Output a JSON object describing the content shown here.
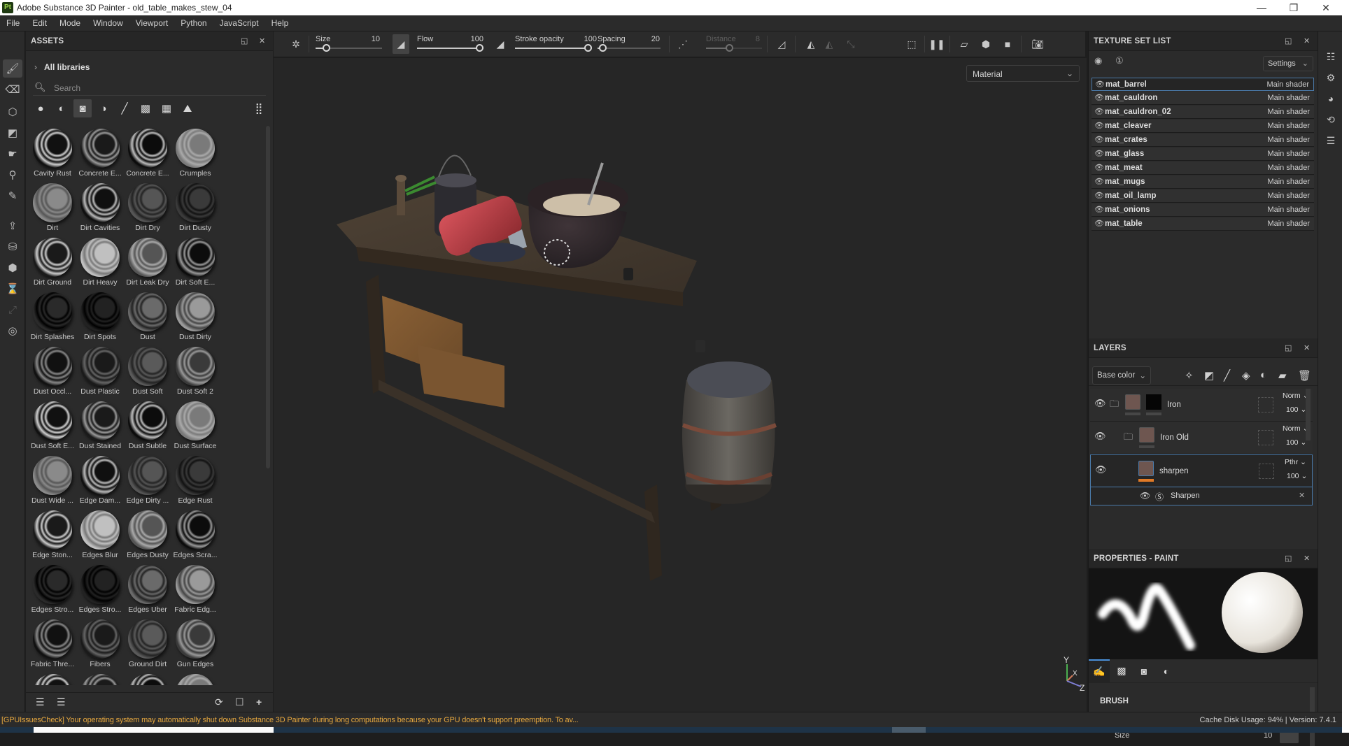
{
  "window": {
    "title": "Adobe Substance 3D Painter - old_table_makes_stew_04",
    "app_icon": "Pt",
    "controls": {
      "minimize": "—",
      "maximize": "❐",
      "close": "✕"
    }
  },
  "menu": [
    "File",
    "Edit",
    "Mode",
    "Window",
    "Viewport",
    "Python",
    "JavaScript",
    "Help"
  ],
  "left_tools": [
    {
      "icon": "paint-brush-icon",
      "glyph": "🖌",
      "active": true
    },
    {
      "icon": "eraser-icon",
      "glyph": "⌫"
    },
    {
      "icon": "projection-icon",
      "glyph": "⬡"
    },
    {
      "icon": "polygon-fill-icon",
      "glyph": "◩"
    },
    {
      "icon": "smudge-icon",
      "glyph": "☛"
    },
    {
      "icon": "clone-stamp-icon",
      "glyph": "⚲"
    },
    {
      "icon": "color-picker-icon",
      "glyph": "✎"
    },
    {
      "icon": "export-icon",
      "glyph": "⇪"
    },
    {
      "icon": "bake-icon",
      "glyph": "⛁"
    },
    {
      "icon": "uv-icon",
      "glyph": "⬢"
    },
    {
      "icon": "hourglass-icon",
      "glyph": "⌛"
    },
    {
      "icon": "transform-icon",
      "glyph": "⤢"
    },
    {
      "icon": "iray-icon",
      "glyph": "◎"
    }
  ],
  "assets": {
    "title": "ASSETS",
    "library": "All libraries",
    "search_placeholder": "Search",
    "filters": [
      {
        "icon": "material-filter-icon",
        "glyph": "●"
      },
      {
        "icon": "smart-material-filter-icon",
        "glyph": "◐"
      },
      {
        "icon": "smart-mask-filter-icon",
        "glyph": "◙",
        "active": true
      },
      {
        "icon": "generator-filter-icon",
        "glyph": "◑"
      },
      {
        "icon": "brush-filter-icon",
        "glyph": "╱"
      },
      {
        "icon": "alpha-filter-icon",
        "glyph": "▩"
      },
      {
        "icon": "texture-filter-icon",
        "glyph": "▦"
      },
      {
        "icon": "environment-filter-icon",
        "glyph": "⛰"
      }
    ],
    "view_toggle_glyph": "⣿",
    "items": [
      "Cavity Rust",
      "Concrete E...",
      "Concrete E...",
      "Crumples",
      "Dirt",
      "Dirt Cavities",
      "Dirt Dry",
      "Dirt Dusty",
      "Dirt Ground",
      "Dirt Heavy",
      "Dirt Leak Dry",
      "Dirt Soft E...",
      "Dirt Splashes",
      "Dirt Spots",
      "Dust",
      "Dust Dirty",
      "Dust Occl...",
      "Dust Plastic",
      "Dust Soft",
      "Dust Soft 2",
      "Dust Soft E...",
      "Dust Stained",
      "Dust Subtle",
      "Dust Surface",
      "Dust Wide ...",
      "Edge Dam...",
      "Edge Dirty ...",
      "Edge Rust",
      "Edge Ston...",
      "Edges Blur",
      "Edges Dusty",
      "Edges Scra...",
      "Edges Stro...",
      "Edges Stro...",
      "Edges Uber",
      "Fabric Edg...",
      "Fabric Thre...",
      "Fibers",
      "Ground Dirt",
      "Gun Edges",
      "",
      "",
      "",
      ""
    ],
    "footer": {
      "save_glyph": "☰",
      "folder_glyph": "☰",
      "refresh_glyph": "⟳",
      "new_glyph": "☐",
      "add_glyph": "+"
    }
  },
  "tool_options": {
    "size": {
      "label": "Size",
      "value": "10",
      "fraction": 0.12
    },
    "flow": {
      "label": "Flow",
      "value": "100",
      "fraction": 1.0
    },
    "stroke_opacity": {
      "label": "Stroke opacity",
      "value": "100",
      "fraction": 1.0
    },
    "spacing": {
      "label": "Spacing",
      "value": "20",
      "fraction": 0.02
    },
    "distance": {
      "label": "Distance",
      "value": "8",
      "fraction": 0.4,
      "disabled": true
    }
  },
  "viewport": {
    "material_mode": "Material",
    "axis": {
      "y": "Y",
      "x": "X",
      "z": "Z"
    }
  },
  "texture_set_list": {
    "title": "TEXTURE SET LIST",
    "settings_label": "Settings",
    "items": [
      {
        "name": "mat_barrel",
        "shader": "Main shader",
        "selected": true
      },
      {
        "name": "mat_cauldron",
        "shader": "Main shader"
      },
      {
        "name": "mat_cauldron_02",
        "shader": "Main shader"
      },
      {
        "name": "mat_cleaver",
        "shader": "Main shader"
      },
      {
        "name": "mat_crates",
        "shader": "Main shader"
      },
      {
        "name": "mat_glass",
        "shader": "Main shader"
      },
      {
        "name": "mat_meat",
        "shader": "Main shader"
      },
      {
        "name": "mat_mugs",
        "shader": "Main shader"
      },
      {
        "name": "mat_oil_lamp",
        "shader": "Main shader"
      },
      {
        "name": "mat_onions",
        "shader": "Main shader"
      },
      {
        "name": "mat_table",
        "shader": "Main shader"
      }
    ]
  },
  "layers": {
    "title": "LAYERS",
    "channel": "Base color",
    "items": [
      {
        "name": "Iron",
        "blend": "Norm",
        "opacity": "100",
        "type": "folder"
      },
      {
        "name": "Iron Old",
        "blend": "Norm",
        "opacity": "100",
        "type": "folder"
      },
      {
        "name": "sharpen",
        "blend": "Pthr",
        "opacity": "100",
        "type": "fill",
        "selected": true
      }
    ],
    "effect": {
      "name": "Sharpen"
    }
  },
  "properties": {
    "title": "PROPERTIES - PAINT",
    "section": "BRUSH",
    "group": "Size",
    "param": "Size",
    "param_value": "10"
  },
  "status": {
    "warning": "[GPUIssuesCheck] Your operating system may automatically shut down Substance 3D Painter during long computations because your GPU doesn't support preemption. To av...",
    "cache": "Cache Disk Usage:   94% | Version: 7.4.1"
  },
  "colors": {
    "accent": "#4a79a8",
    "warning": "#e7a83f",
    "panel_bg": "#2b2b2b",
    "viewport_bg": "#262626"
  }
}
